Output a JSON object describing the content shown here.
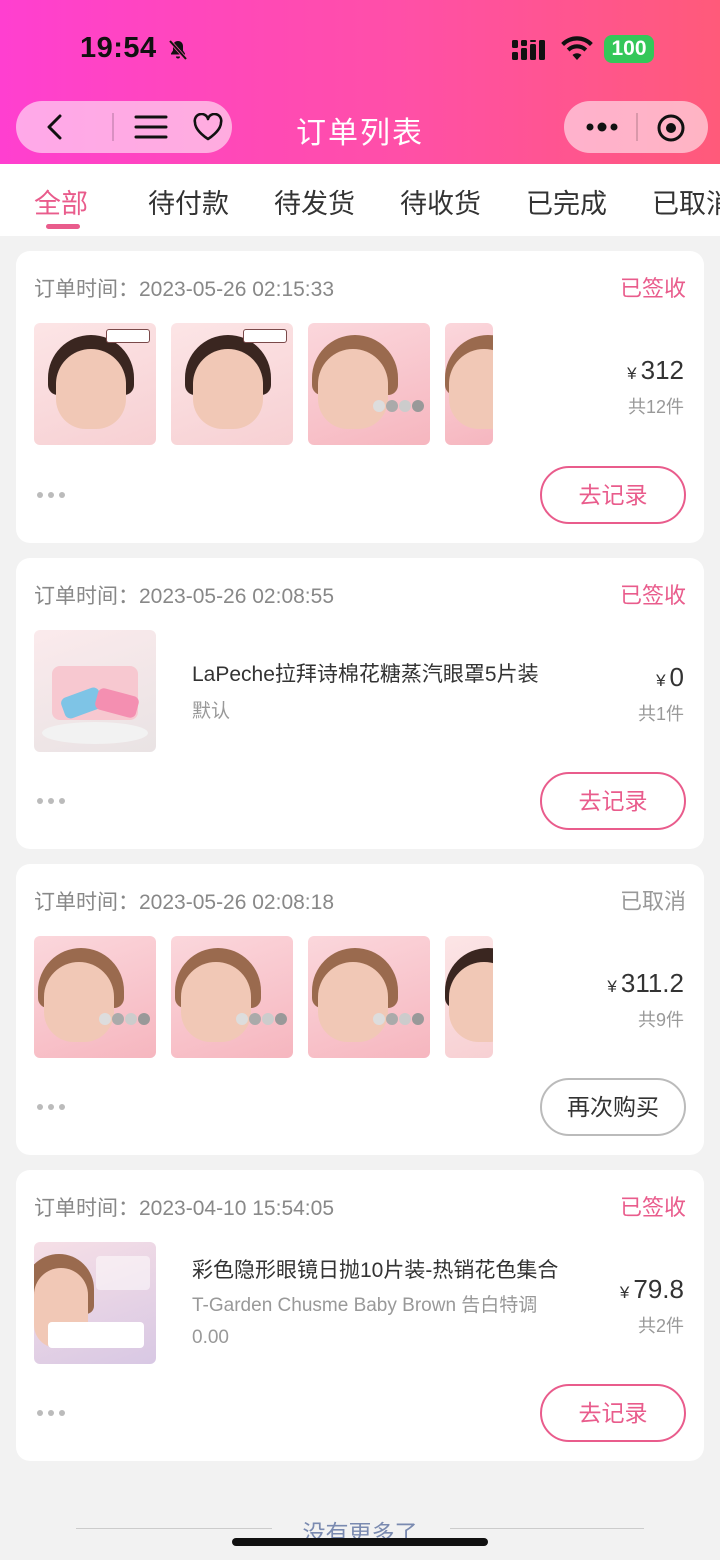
{
  "status_bar": {
    "time": "19:54",
    "battery": "100"
  },
  "nav": {
    "title": "订单列表"
  },
  "tabs": [
    {
      "label": "全部",
      "active": true
    },
    {
      "label": "待付款"
    },
    {
      "label": "待发货"
    },
    {
      "label": "待收货"
    },
    {
      "label": "已完成"
    },
    {
      "label": "已取消"
    }
  ],
  "orders": [
    {
      "time_label": "订单时间：",
      "time": "2023-05-26 02:15:33",
      "status": "已签收",
      "price": "312",
      "count": "共12件",
      "action": "去记录"
    },
    {
      "time_label": "订单时间：",
      "time": "2023-05-26 02:08:55",
      "status": "已签收",
      "product_title": "LaPeche拉拜诗棉花糖蒸汽眼罩5片装",
      "product_sub": "默认",
      "price": "0",
      "count": "共1件",
      "action": "去记录"
    },
    {
      "time_label": "订单时间：",
      "time": "2023-05-26 02:08:18",
      "status": "已取消",
      "price": "311.2",
      "count": "共9件",
      "action": "再次购买"
    },
    {
      "time_label": "订单时间：",
      "time": "2023-04-10 15:54:05",
      "status": "已签收",
      "product_title": "彩色隐形眼镜日抛10片装-热销花色集合",
      "product_sub_line1": "T-Garden Chusme Baby Brown 告白特调",
      "product_sub_line2": "0.00",
      "price": "79.8",
      "count": "共2件",
      "action": "去记录"
    }
  ],
  "currency": "¥",
  "footer": "没有更多了",
  "colors": {
    "accent": "#e95c8c",
    "header_start": "#ff3fd0",
    "header_end": "#ff5a7a"
  }
}
